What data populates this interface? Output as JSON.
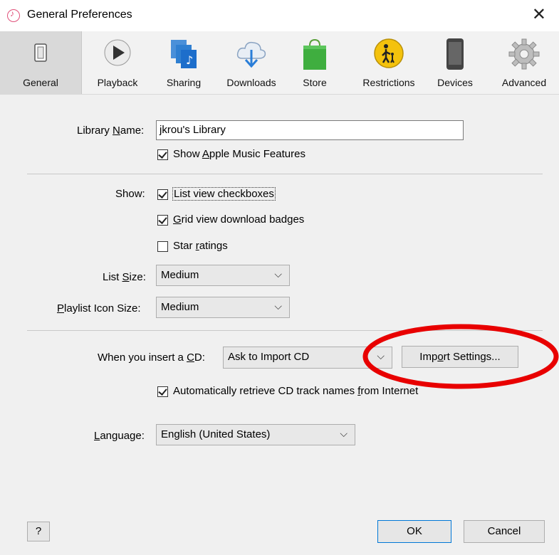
{
  "window": {
    "title": "General Preferences",
    "close_glyph": "✕"
  },
  "toolbar": {
    "tabs": [
      {
        "label": "General",
        "icon": "switch-icon"
      },
      {
        "label": "Playback",
        "icon": "play-icon"
      },
      {
        "label": "Sharing",
        "icon": "sharing-icon"
      },
      {
        "label": "Downloads",
        "icon": "download-cloud-icon"
      },
      {
        "label": "Store",
        "icon": "store-bag-icon"
      },
      {
        "label": "Restrictions",
        "icon": "parental-icon"
      },
      {
        "label": "Devices",
        "icon": "device-icon"
      },
      {
        "label": "Advanced",
        "icon": "gear-icon"
      }
    ],
    "selected": "General"
  },
  "library": {
    "label_pre": "Library ",
    "label_u": "N",
    "label_post": "ame:",
    "value": "jkrou's Library",
    "apple_music": {
      "pre": "Show ",
      "u": "A",
      "post": "pple Music Features",
      "checked": true
    }
  },
  "show": {
    "label": "Show:",
    "list_view": {
      "label": "List view checkboxes",
      "checked": true
    },
    "grid_view": {
      "u": "G",
      "post": "rid view download badges",
      "checked": true
    },
    "star": {
      "pre": "Star ",
      "u": "r",
      "post": "atings",
      "checked": false
    }
  },
  "list_size": {
    "pre": "List ",
    "u": "S",
    "post": "ize:",
    "value": "Medium"
  },
  "playlist_icon_size": {
    "u": "P",
    "post": "laylist Icon Size:",
    "value": "Medium"
  },
  "cd": {
    "pre": "When you insert a ",
    "u": "C",
    "post": "D:",
    "value": "Ask to Import CD",
    "import_pre": "Imp",
    "import_u": "o",
    "import_post": "rt Settings...",
    "auto": {
      "pre": "Automatically retrieve CD track names ",
      "u": "f",
      "post": "rom Internet",
      "checked": true
    }
  },
  "language": {
    "u": "L",
    "post": "anguage:",
    "value": "English (United States)"
  },
  "footer": {
    "help": "?",
    "ok": "OK",
    "cancel": "Cancel"
  },
  "colors": {
    "highlight": "#e80000",
    "focus": "#0078d7"
  }
}
